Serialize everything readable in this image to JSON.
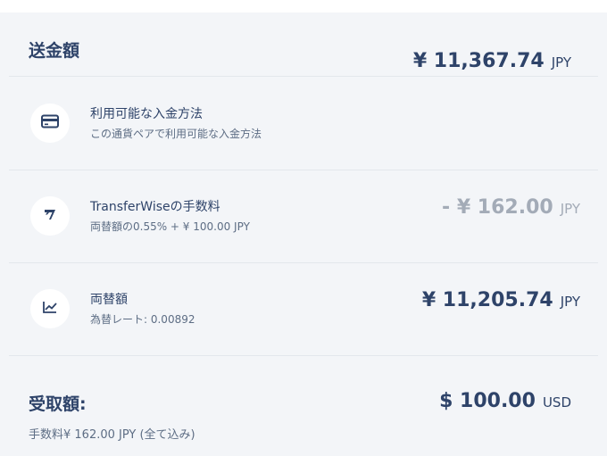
{
  "send": {
    "label": "送金額",
    "amount": "¥ 11,367.74",
    "currency": "JPY"
  },
  "payment_method": {
    "icon": "credit-card-icon",
    "title": "利用可能な入金方法",
    "subtitle": "この通貨ペアで利用可能な入金方法"
  },
  "fee": {
    "icon": "transferwise-logo-icon",
    "title": "TransferWiseの手数料",
    "subtitle": "両替額の0.55% + ¥ 100.00 JPY",
    "amount": "- ¥ 162.00",
    "currency": "JPY"
  },
  "exchange": {
    "icon": "chart-line-icon",
    "title": "両替額",
    "subtitle": "為替レート: 0.00892",
    "amount": "¥ 11,205.74",
    "currency": "JPY"
  },
  "receive": {
    "label": "受取額:",
    "amount": "$ 100.00",
    "currency": "USD",
    "note": "手数料¥ 162.00 JPY (全て込み)"
  },
  "colors": {
    "background": "#f3f5f8",
    "text": "#2e4369",
    "muted": "#a3abb7",
    "divider": "#e3e7ec"
  }
}
